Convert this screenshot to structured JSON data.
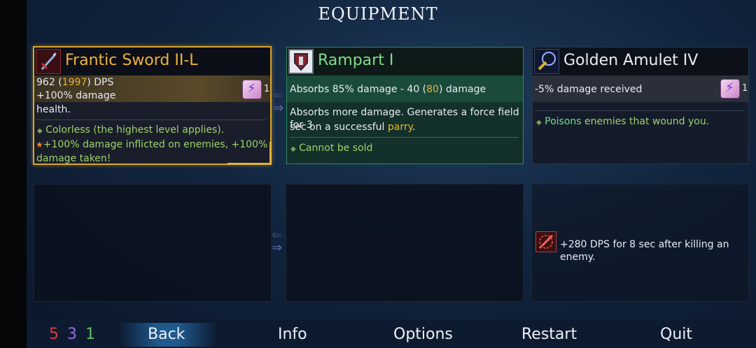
{
  "title": "EQUIPMENT",
  "sword": {
    "name": "Frantic Sword II-L",
    "dps_value": "962",
    "dps_paren_open": "(",
    "dps_alt": "1997",
    "dps_paren_close": ")",
    "dps_unit": "DPS",
    "line2": "+100% damage",
    "line3": "health.",
    "scroll_count": "1",
    "note1": "Colorless (the highest level applies).",
    "note2": "+100% damage inflicted on enemies, +100%",
    "note3": "damage taken!"
  },
  "rampart": {
    "name": "Rampart I",
    "stat_prefix": "Absorbs 85% damage - 40 (",
    "stat_alt": "80",
    "stat_suffix": ") damage",
    "desc1": "Absorbs more damage. Generates a force field for 3",
    "desc2_prefix": "sec on a successful ",
    "desc2_link": "parry",
    "desc2_suffix": ".",
    "note": "Cannot be sold"
  },
  "amulet": {
    "name": "Golden Amulet IV",
    "stat": "-5% damage received",
    "scroll_count": "1",
    "note_hl": "Poisons",
    "note_rest": " enemies that wound you."
  },
  "mutation": {
    "text": "+280 DPS for 8 sec after killing an enemy."
  },
  "scrolls": {
    "red": "5",
    "purple": "3",
    "green": "1"
  },
  "nav": {
    "back": "Back",
    "info": "Info",
    "options": "Options",
    "restart": "Restart",
    "quit": "Quit"
  }
}
